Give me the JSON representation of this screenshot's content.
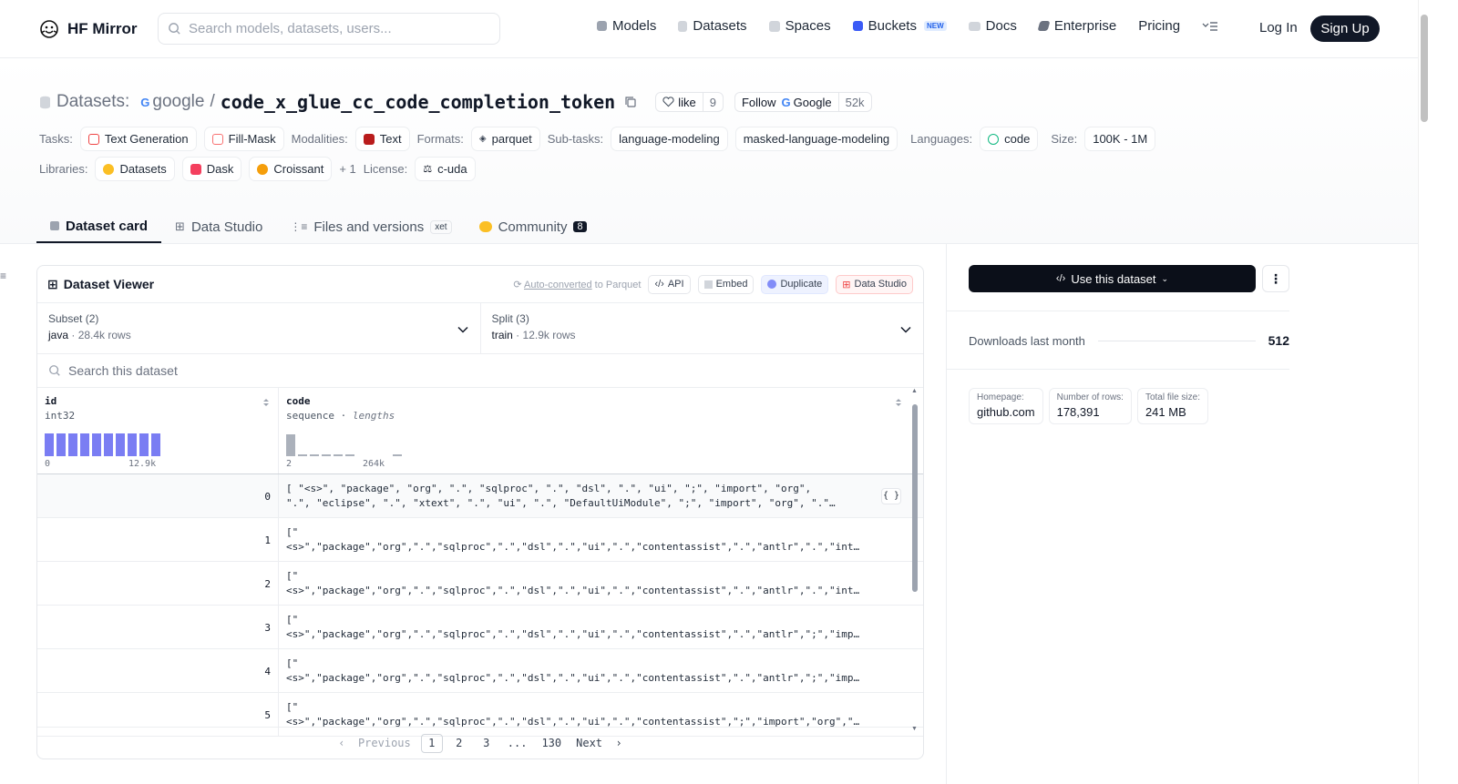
{
  "header": {
    "brand": "HF Mirror",
    "search_placeholder": "Search models, datasets, users...",
    "nav": [
      {
        "label": "Models",
        "icon": "cube-icon"
      },
      {
        "label": "Datasets",
        "icon": "database-icon"
      },
      {
        "label": "Spaces",
        "icon": "grid-icon"
      },
      {
        "label": "Buckets",
        "icon": "bucket-icon",
        "badge": "NEW"
      },
      {
        "label": "Docs",
        "icon": "book-icon"
      },
      {
        "label": "Enterprise",
        "icon": "enterprise-icon"
      },
      {
        "label": "Pricing"
      }
    ],
    "login": "Log In",
    "signup": "Sign Up"
  },
  "repo": {
    "section": "Datasets:",
    "owner": "google",
    "sep": "/",
    "name": "code_x_glue_cc_code_completion_token",
    "like_label": "like",
    "like_count": "9",
    "follow_label": "Follow",
    "follow_org": "Google",
    "followers": "52k"
  },
  "tags": {
    "tasks_label": "Tasks:",
    "tasks": [
      "Text Generation",
      "Fill-Mask"
    ],
    "modalities_label": "Modalities:",
    "modalities": [
      "Text"
    ],
    "formats_label": "Formats:",
    "formats": [
      "parquet"
    ],
    "subtasks_label": "Sub-tasks:",
    "subtasks": [
      "language-modeling",
      "masked-language-modeling"
    ],
    "languages_label": "Languages:",
    "languages": [
      "code"
    ],
    "size_label": "Size:",
    "size": "100K - 1M",
    "libraries_label": "Libraries:",
    "libraries": [
      "Datasets",
      "Dask",
      "Croissant"
    ],
    "libraries_more": "+ 1",
    "license_label": "License:",
    "license": "c-uda"
  },
  "tabs": [
    {
      "label": "Dataset card",
      "active": true
    },
    {
      "label": "Data Studio"
    },
    {
      "label": "Files and versions",
      "badge": "xet"
    },
    {
      "label": "Community",
      "count": "8"
    }
  ],
  "viewer": {
    "title": "Dataset Viewer",
    "auto_converted": "Auto-converted",
    "to_parquet": " to Parquet",
    "api": "API",
    "embed": "Embed",
    "duplicate": "Duplicate",
    "data_studio": "Data Studio",
    "subset_label": "Subset (2)",
    "subset_value": "java",
    "subset_rows": "28.4k rows",
    "split_label": "Split (3)",
    "split_value": "train",
    "split_rows": "12.9k rows",
    "search_placeholder": "Search this dataset",
    "columns": [
      {
        "name": "id",
        "type": "int32",
        "min": "0",
        "max": "12.9k"
      },
      {
        "name": "code",
        "type": "sequence",
        "subtype": "lengths",
        "min": "2",
        "max": "264k"
      }
    ],
    "rows": [
      {
        "id": "0",
        "line1": "[ \"<s>\", \"package\", \"org\", \".\", \"sqlproc\", \".\", \"dsl\", \".\", \"ui\", \";\", \"import\", \"org\",",
        "line2": "\".\", \"eclipse\", \".\", \"xtext\", \".\", \"ui\", \".\", \"DefaultUiModule\", \";\", \"import\", \"org\", \".\"…"
      },
      {
        "id": "1",
        "line1": "[\"",
        "line2": "<s>\",\"package\",\"org\",\".\",\"sqlproc\",\".\",\"dsl\",\".\",\"ui\",\".\",\"contentassist\",\".\",\"antlr\",\".\",\"int…"
      },
      {
        "id": "2",
        "line1": "[\"",
        "line2": "<s>\",\"package\",\"org\",\".\",\"sqlproc\",\".\",\"dsl\",\".\",\"ui\",\".\",\"contentassist\",\".\",\"antlr\",\".\",\"int…"
      },
      {
        "id": "3",
        "line1": "[\"",
        "line2": "<s>\",\"package\",\"org\",\".\",\"sqlproc\",\".\",\"dsl\",\".\",\"ui\",\".\",\"contentassist\",\".\",\"antlr\",\";\",\"imp…"
      },
      {
        "id": "4",
        "line1": "[\"",
        "line2": "<s>\",\"package\",\"org\",\".\",\"sqlproc\",\".\",\"dsl\",\".\",\"ui\",\".\",\"contentassist\",\".\",\"antlr\",\";\",\"imp…"
      },
      {
        "id": "5",
        "line1": "[\"",
        "line2": "<s>\",\"package\",\"org\",\".\",\"sqlproc\",\".\",\"dsl\",\".\",\"ui\",\".\",\"contentassist\",\";\",\"import\",\"org\",\"…"
      }
    ],
    "pager": {
      "prev": "Previous",
      "pages": [
        "1",
        "2",
        "3",
        "...",
        "130"
      ],
      "current": "1",
      "next": "Next"
    }
  },
  "sidebar": {
    "use_button": "Use this dataset",
    "downloads_label": "Downloads last month",
    "downloads_value": "512",
    "facts": [
      {
        "label": "Homepage:",
        "value": "github.com"
      },
      {
        "label": "Number of rows:",
        "value": "178,391"
      },
      {
        "label": "Total file size:",
        "value": "241 MB"
      }
    ]
  },
  "colors": {
    "accent": "#6366f1",
    "dark": "#111827",
    "border": "#e5e7eb"
  }
}
